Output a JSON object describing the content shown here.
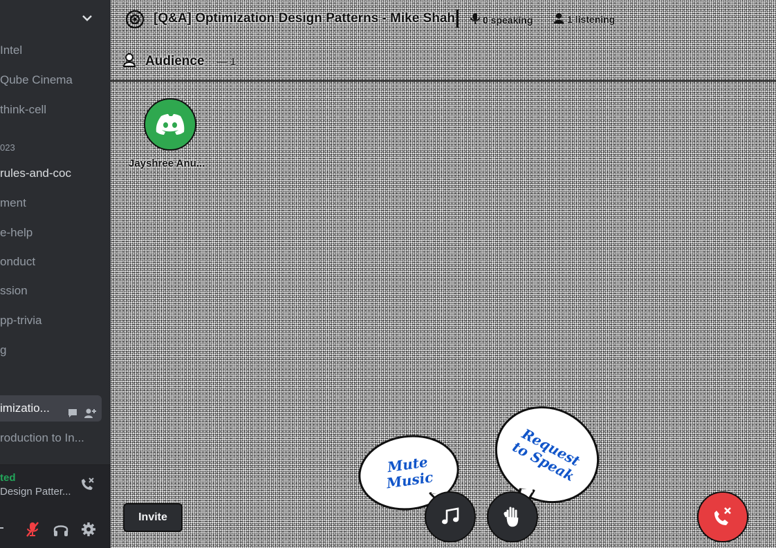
{
  "sidebar": {
    "channels": [
      {
        "label": "Intel",
        "style": "normal"
      },
      {
        "label": "Qube Cinema",
        "style": "normal"
      },
      {
        "label": "think-cell",
        "style": "normal"
      },
      {
        "label": "023",
        "style": "category"
      },
      {
        "label": "rules-and-coc",
        "style": "bright"
      },
      {
        "label": "ment",
        "style": "normal"
      },
      {
        "label": "e-help",
        "style": "normal"
      },
      {
        "label": "onduct",
        "style": "normal"
      },
      {
        "label": "ssion",
        "style": "normal"
      },
      {
        "label": "pp-trivia",
        "style": "normal"
      },
      {
        "label": "g",
        "style": "normal"
      },
      {
        "label": "imizatio...",
        "style": "selected"
      },
      {
        "label": "roduction to In...",
        "style": "normal"
      }
    ],
    "voice_status": "ted",
    "voice_channel": "Design Patter...",
    "colors": {
      "bg": "#2b2d31",
      "connected": "#23a55a",
      "muted": "#f23f43"
    }
  },
  "stage": {
    "title": "[Q&A] Optimization Design Patterns - Mike Shah",
    "speaking_label": "0 speaking",
    "listening_label": "1 listening",
    "audience_label": "Audience",
    "audience_count": "— 1",
    "members": [
      {
        "name": "Jayshree Anu..."
      }
    ],
    "invite_label": "Invite",
    "bubble_mute": [
      "Mute",
      "Music"
    ],
    "bubble_request": [
      "Request",
      "to Speak"
    ],
    "colors": {
      "leave": "#e63c3f",
      "avatar": "#2fa84f",
      "bubble_text": "#1155c9"
    }
  }
}
